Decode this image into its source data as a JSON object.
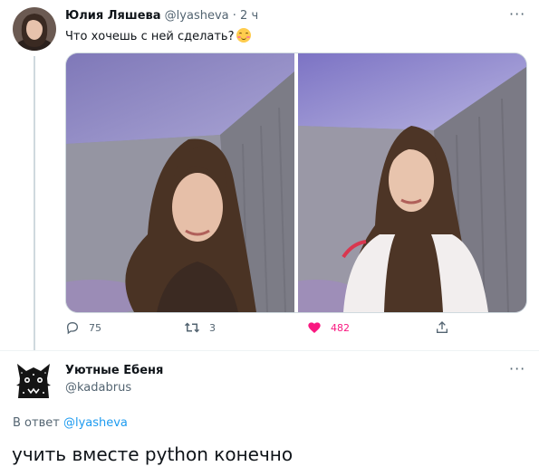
{
  "tweet": {
    "author_name": "Юлия Ляшева",
    "author_handle": "@lyasheva",
    "separator": "·",
    "time": "2 ч",
    "text": "Что хочешь с ней сделать?",
    "emoji": "smiling-face-with-blush-emoji",
    "more": "···",
    "media": [
      {
        "alt": "photo-1"
      },
      {
        "alt": "photo-2"
      }
    ],
    "stats": {
      "replies": "75",
      "retweets": "3",
      "likes": "482"
    },
    "colors": {
      "like_active": "#f91880",
      "muted": "#536471",
      "link": "#1d9bf0"
    }
  },
  "reply": {
    "author_name": "Уютные Ебеня",
    "author_handle": "@kadabrus",
    "more": "···",
    "reply_to_prefix": "В ответ",
    "reply_to_handle": "@lyasheva",
    "text": "учить вместе python конечно"
  }
}
